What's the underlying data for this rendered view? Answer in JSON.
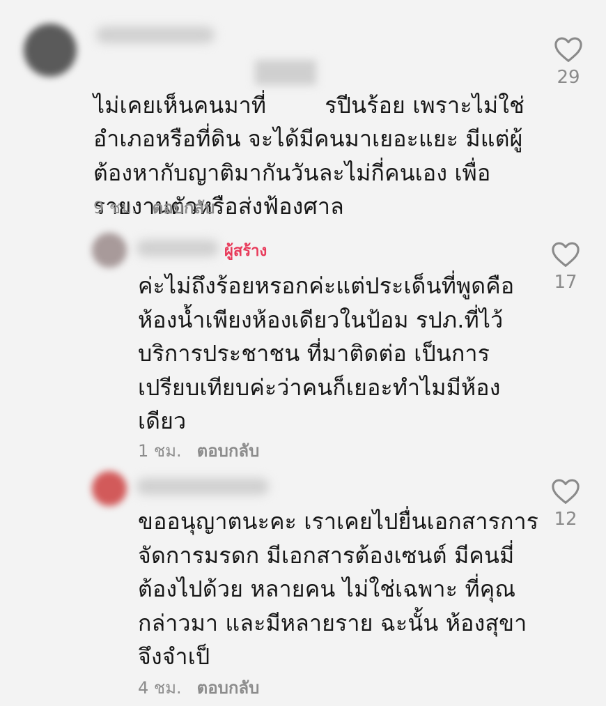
{
  "comments": [
    {
      "body_line1_a": "ไม่เคยเห็นคนมาที่",
      "body_line1_b": "รปีนร้อย เพราะไม่ใช่",
      "body_rest": "อำเภอหรือที่ดิน จะได้มีคนมาเยอะแยะ มีแต่ผู้\nต้องหากับญาติมากันวันละไม่กี่คนเอง เพื่อ\nรายงานตัวหรือส่งฟ้องศาล",
      "time": "9 ชม.",
      "reply_label": "ตอบกลับ",
      "likes": "29",
      "avatar_color": "#5a5a5a"
    },
    {
      "creator_badge": "ผู้สร้าง",
      "body": "ค่ะไม่ถึงร้อยหรอกค่ะแต่ประเด็นที่พูดคือ\nห้องน้ำเพียงห้องเดียวในป้อม รปภ.ที่ไว้\nบริการประชาชน ที่มาติดต่อ เป็นการ\nเปรียบเทียบค่ะว่าคนก็เยอะทำไมมีห้อง\nเดียว",
      "time": "1 ชม.",
      "reply_label": "ตอบกลับ",
      "likes": "17",
      "avatar_color": "#a89a9a"
    },
    {
      "body": "ขออนุญาตนะคะ เราเคยไปยื่นเอกสารการ\nจัดการมรดก มีเอกสารต้องเซนต์ มีคนมี่\nต้องไปด้วย หลายคน ไม่ใช่เฉพาะ ที่คุณ\nกล่าวมา และมีหลายราย ฉะนั้น ห้องสุขา\nจึงจำเป็",
      "time": "4 ชม.",
      "reply_label": "ตอบกลับ",
      "likes": "12",
      "avatar_color": "#d25a5a"
    }
  ],
  "colors": {
    "creator_badge": "#e83a5a",
    "muted_text": "#8c8c8c",
    "background": "#f3f3f3"
  },
  "icons": {
    "like": "heart-outline-icon"
  }
}
